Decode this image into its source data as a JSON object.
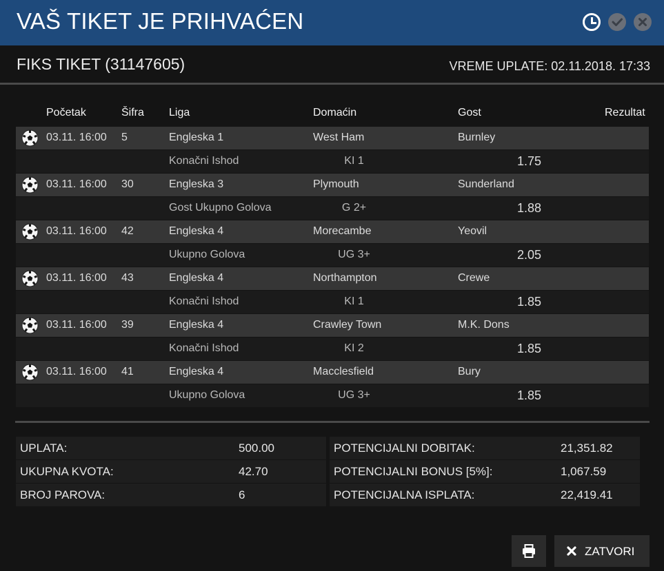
{
  "header": {
    "title": "VAŠ TIKET JE PRIHVAĆEN",
    "icons": [
      "clock-icon",
      "check-circle-icon",
      "close-circle-icon"
    ],
    "accent_color": "#1e4a7c"
  },
  "ticket": {
    "title": "FIKS TIKET (31147605)",
    "paid_time": "VREME UPLATE: 02.11.2018. 17:33"
  },
  "table": {
    "columns": [
      "Početak",
      "Šifra",
      "Liga",
      "Domaćin",
      "Gost",
      "Rezultat"
    ],
    "rows": [
      {
        "start": "03.11. 16:00",
        "code": "5",
        "league": "Engleska 1",
        "home": "West Ham",
        "away": "Burnley",
        "market": "Konačni Ishod",
        "pick": "KI 1",
        "odd": "1.75"
      },
      {
        "start": "03.11. 16:00",
        "code": "30",
        "league": "Engleska 3",
        "home": "Plymouth",
        "away": "Sunderland",
        "market": "Gost Ukupno Golova",
        "pick": "G 2+",
        "odd": "1.88"
      },
      {
        "start": "03.11. 16:00",
        "code": "42",
        "league": "Engleska 4",
        "home": "Morecambe",
        "away": "Yeovil",
        "market": "Ukupno Golova",
        "pick": "UG 3+",
        "odd": "2.05"
      },
      {
        "start": "03.11. 16:00",
        "code": "43",
        "league": "Engleska 4",
        "home": "Northampton",
        "away": "Crewe",
        "market": "Konačni Ishod",
        "pick": "KI 1",
        "odd": "1.85"
      },
      {
        "start": "03.11. 16:00",
        "code": "39",
        "league": "Engleska 4",
        "home": "Crawley Town",
        "away": "M.K. Dons",
        "market": "Konačni Ishod",
        "pick": "KI 2",
        "odd": "1.85"
      },
      {
        "start": "03.11. 16:00",
        "code": "41",
        "league": "Engleska 4",
        "home": "Macclesfield",
        "away": "Bury",
        "market": "Ukupno Golova",
        "pick": "UG 3+",
        "odd": "1.85"
      }
    ]
  },
  "summary": {
    "left": [
      {
        "label": "UPLATA:",
        "value": "500.00"
      },
      {
        "label": "UKUPNA KVOTA:",
        "value": "42.70"
      },
      {
        "label": "BROJ PAROVA:",
        "value": "6"
      }
    ],
    "right": [
      {
        "label": "POTENCIJALNI DOBITAK:",
        "value": "21,351.82"
      },
      {
        "label": "POTENCIJALNI BONUS [5%]:",
        "value": "1,067.59"
      },
      {
        "label": "POTENCIJALNA ISPLATA:",
        "value": "22,419.41"
      }
    ]
  },
  "buttons": {
    "print_icon": "printer-icon",
    "close_label": "ZATVORI",
    "close_icon": "x-icon"
  }
}
